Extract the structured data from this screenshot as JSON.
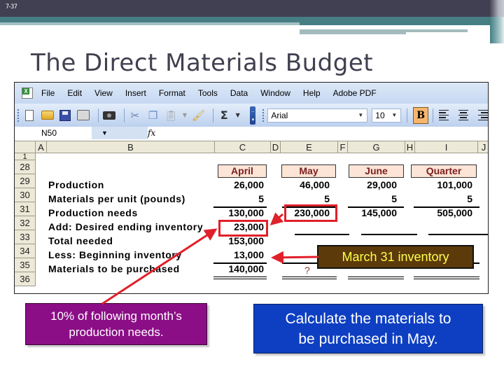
{
  "slide": {
    "number": "7-37",
    "title": "The Direct Materials Budget"
  },
  "excel": {
    "menu": [
      "File",
      "Edit",
      "View",
      "Insert",
      "Format",
      "Tools",
      "Data",
      "Window",
      "Help",
      "Adobe PDF"
    ],
    "toolbar": {
      "font_name": "Arial",
      "font_size": "10",
      "bold_label": "B",
      "sum_label": "Σ"
    },
    "formula_bar": {
      "name_box": "N50",
      "fx_label": "fx",
      "formula": ""
    },
    "columns": [
      "A",
      "B",
      "C",
      "D",
      "E",
      "F",
      "G",
      "H",
      "I",
      "J"
    ],
    "rows": [
      "1",
      "28",
      "29",
      "30",
      "31",
      "32",
      "33",
      "34",
      "35",
      "36"
    ],
    "headers": [
      "April",
      "May",
      "June",
      "Quarter"
    ],
    "line_items": [
      {
        "row": "29",
        "label": "Production",
        "values": [
          "26,000",
          "46,000",
          "29,000",
          "101,000"
        ]
      },
      {
        "row": "30",
        "label": "Materials per unit (pounds)",
        "values": [
          "5",
          "5",
          "5",
          "5"
        ]
      },
      {
        "row": "31",
        "label": "Production needs",
        "values": [
          "130,000",
          "230,000",
          "145,000",
          "505,000"
        ]
      },
      {
        "row": "32",
        "label": "Add: Desired ending inventory",
        "values": [
          "23,000",
          "",
          "",
          ""
        ]
      },
      {
        "row": "33",
        "label": "Total needed",
        "values": [
          "153,000",
          "",
          "",
          ""
        ]
      },
      {
        "row": "34",
        "label": "Less: Beginning inventory",
        "values": [
          "13,000",
          "",
          "",
          ""
        ]
      },
      {
        "row": "35",
        "label": "Materials to be purchased",
        "values": [
          "140,000",
          "?",
          "",
          ""
        ]
      }
    ]
  },
  "callouts": {
    "march_inventory": "March 31 inventory",
    "ending_inventory_note_line1": "10% of following month’s",
    "ending_inventory_note_line2": "production needs.",
    "task_line1": "Calculate the materials to",
    "task_line2": "be purchased in May."
  },
  "colors": {
    "header_band": "#414052",
    "teal_band": "#467e84",
    "highlight_red": "#e0202a",
    "month_header_fill": "#fce4d6",
    "month_header_text": "#7b1f1f",
    "march_callout_fill": "#5c3a0a",
    "march_callout_text": "#ffff4d",
    "purple_callout": "#8b0e86",
    "blue_callout": "#0e3fc2"
  }
}
